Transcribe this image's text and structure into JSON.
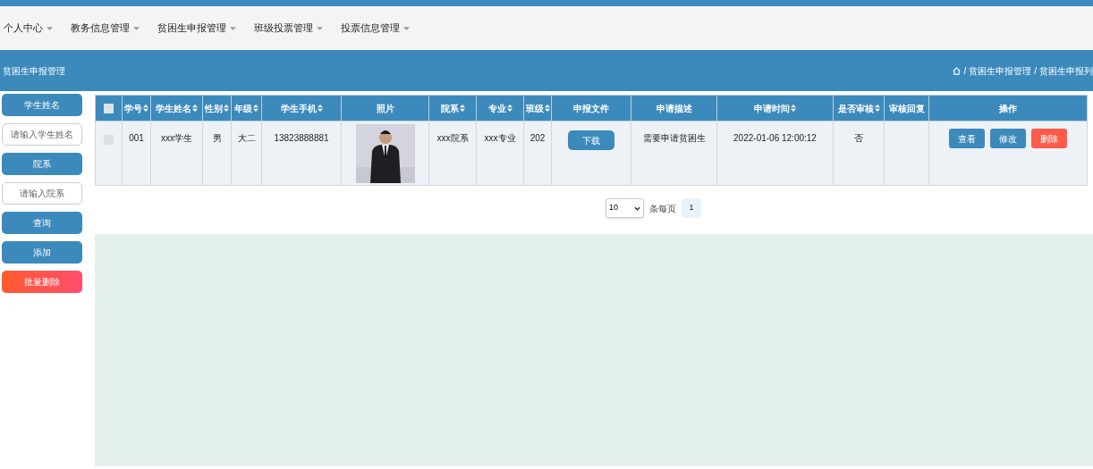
{
  "nav": [
    {
      "label": "个人中心"
    },
    {
      "label": "教务信息管理"
    },
    {
      "label": "贫困生申报管理"
    },
    {
      "label": "班级投票管理"
    },
    {
      "label": "投票信息管理"
    }
  ],
  "header": {
    "title": "贫困生申报管理",
    "breadcrumb": [
      "贫困生申报管理",
      "贫困生申报列"
    ],
    "separator": "/"
  },
  "sidebar": [
    {
      "kind": "label",
      "text": "学生姓名"
    },
    {
      "kind": "field",
      "placeholder": "请输入学生姓名"
    },
    {
      "kind": "label",
      "text": "院系"
    },
    {
      "kind": "field",
      "placeholder": "请输入院系"
    },
    {
      "kind": "button",
      "text": "查询"
    },
    {
      "kind": "button",
      "text": "添加"
    },
    {
      "kind": "danger",
      "text": "批量删除"
    }
  ],
  "table": {
    "select_all": {
      "checked": false
    },
    "columns": [
      {
        "label": "学号",
        "sortable": true
      },
      {
        "label": "学生姓名",
        "sortable": true
      },
      {
        "label": "性别",
        "sortable": true
      },
      {
        "label": "年级",
        "sortable": true
      },
      {
        "label": "学生手机",
        "sortable": true
      },
      {
        "label": "照片",
        "sortable": false
      },
      {
        "label": "院系",
        "sortable": true
      },
      {
        "label": "专业",
        "sortable": true
      },
      {
        "label": "班级",
        "sortable": true
      },
      {
        "label": "申报文件",
        "sortable": false
      },
      {
        "label": "申请描述",
        "sortable": false
      },
      {
        "label": "申请时间",
        "sortable": true
      },
      {
        "label": "是否审核",
        "sortable": true
      },
      {
        "label": "审核回复",
        "sortable": false
      },
      {
        "label": "操作",
        "sortable": false
      }
    ],
    "rows": [
      {
        "checked": false,
        "cells": [
          "001",
          "xxx学生",
          "男",
          "大二",
          "13823888881",
          {
            "kind": "picture"
          },
          "xxx院系",
          "xxx专业",
          "202",
          {
            "kind": "button",
            "text": "下载"
          },
          "需要申请贫困生",
          "2022-01-06 12:00:12",
          "否",
          "",
          {
            "kind": "actions",
            "buttons": [
              {
                "text": "查看",
                "kind": "primary"
              },
              {
                "text": "修改",
                "kind": "primary"
              },
              {
                "text": "删除",
                "kind": "danger"
              }
            ]
          }
        ]
      }
    ]
  },
  "pagination": {
    "page_size": "10",
    "per_page_label": "条每页",
    "pages": [
      {
        "label": "1",
        "selected": true
      }
    ]
  }
}
